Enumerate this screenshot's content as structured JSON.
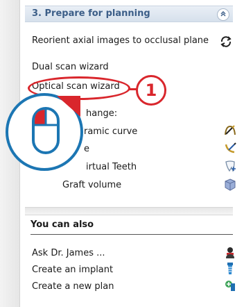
{
  "section": {
    "title": "3. Prepare for planning",
    "collapse_glyph": "»"
  },
  "items": {
    "reorient": "Reorient axial images to occlusal plane",
    "dual_scan": "Dual scan wizard",
    "optical_scan": "Optical scan wizard",
    "change_label": "hange:",
    "panoramic_curve": "ramic curve",
    "nerve": "e",
    "virtual_teeth": "irtual Teeth",
    "graft_volume": "Graft volume"
  },
  "you_can_also": {
    "title": "You can also",
    "items": [
      "Ask Dr. James ...",
      "Create an implant",
      "Create a new plan"
    ]
  },
  "callout": {
    "number": "1"
  },
  "colors": {
    "callout_red": "#d9262c",
    "mouse_blue": "#1c76b3",
    "header_text": "#3c5e88"
  },
  "icons": {
    "reorient": "rotate-arrows-icon",
    "panoramic": "panoramic-curve-icon",
    "nerve": "nerve-icon",
    "teeth": "virtual-tooth-icon",
    "graft": "graft-cube-icon",
    "ask": "doctor-icon",
    "implant": "implant-icon",
    "plan": "new-plan-icon",
    "mouse": "mouse-left-click-icon"
  }
}
